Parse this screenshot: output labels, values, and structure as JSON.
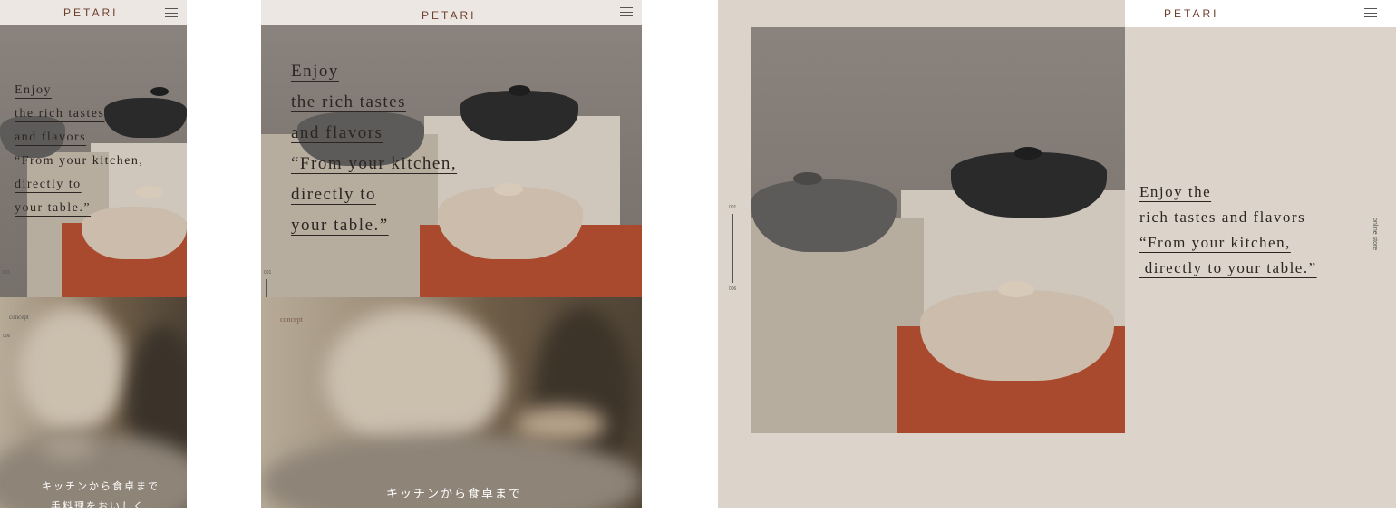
{
  "brand": "PETARI",
  "hero": {
    "lines_mobile": [
      "Enjoy",
      "the rich tastes",
      "and flavors",
      "“From your kitchen,",
      "directly to",
      "your table.”"
    ],
    "lines_tablet": [
      "Enjoy",
      "the rich tastes",
      "and flavors",
      "“From your kitchen,",
      "directly to",
      "your table.”"
    ],
    "lines_desktop": [
      "Enjoy the",
      "rich tastes and flavors",
      "“From your kitchen,",
      " directly to your table.”"
    ]
  },
  "indicator": {
    "start": "001",
    "end": "006"
  },
  "concept_label": "concept",
  "online_store_label": "online store",
  "japanese_caption": "キッチンから食卓まで",
  "japanese_caption_2": "手料理をおいしく",
  "colors": {
    "logo": "#6e3e2c",
    "header_bg": "#ece7e2",
    "desktop_bg": "#dcd4ca",
    "terracotta": "#a9492e"
  }
}
